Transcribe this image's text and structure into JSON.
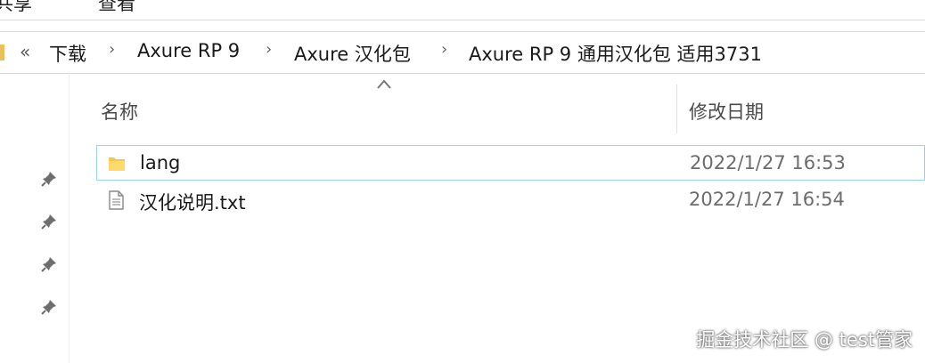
{
  "ribbon": {
    "tab_share": "共享",
    "tab_view": "查看"
  },
  "address": {
    "overflow": "«",
    "crumbs": [
      "下载",
      "Axure RP 9",
      "Axure 汉化包",
      "Axure RP 9 通用汉化包 适用3731"
    ],
    "separator": "›"
  },
  "columns": {
    "name": "名称",
    "date_modified": "修改日期"
  },
  "files": [
    {
      "name": "lang",
      "date": "2022/1/27 16:53",
      "type": "folder"
    },
    {
      "name": "汉化说明.txt",
      "date": "2022/1/27 16:54",
      "type": "text-file"
    }
  ],
  "watermark": "掘金技术社区 @ test管家",
  "colors": {
    "selection_border": "#99d1ff",
    "folder": "#f5c84c",
    "header_text": "#4a4a4a",
    "date_text": "#6d6d6d"
  }
}
